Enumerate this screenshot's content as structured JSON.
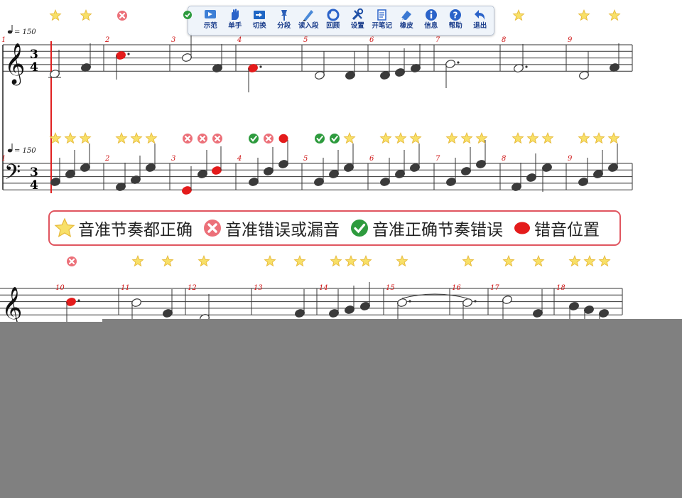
{
  "toolbar": {
    "buttons": [
      {
        "label": "示范",
        "icon": "demo-icon"
      },
      {
        "label": "单手",
        "icon": "single-hand-icon"
      },
      {
        "label": "切换",
        "icon": "switch-icon"
      },
      {
        "label": "分段",
        "icon": "segment-pin-icon"
      },
      {
        "label": "读入段",
        "icon": "load-segment-icon"
      },
      {
        "label": "回顾",
        "icon": "review-icon"
      },
      {
        "label": "设置",
        "icon": "settings-tools-icon"
      },
      {
        "label": "开笔记",
        "icon": "note-pen-icon"
      },
      {
        "label": "橡皮",
        "icon": "eraser-icon"
      },
      {
        "label": "信息",
        "icon": "info-icon"
      },
      {
        "label": "帮助",
        "icon": "help-icon"
      },
      {
        "label": "退出",
        "icon": "exit-arrow-icon"
      }
    ]
  },
  "score": {
    "tempo": "= 150",
    "time_signature": {
      "top": "3",
      "bottom": "4"
    },
    "system1_measures": [
      "1",
      "2",
      "3",
      "4",
      "5",
      "6",
      "7",
      "8",
      "9"
    ],
    "system2_measures": [
      "10",
      "11",
      "12",
      "13",
      "14",
      "15",
      "16",
      "17",
      "18"
    ],
    "treble_marks_row1": [
      [
        "star",
        "star",
        "cross"
      ],
      [],
      [],
      [],
      [],
      [],
      [],
      [
        "star"
      ],
      [
        "star",
        "star"
      ]
    ],
    "bass_marks_row1": [
      [
        "star",
        "star",
        "star"
      ],
      [
        "star",
        "star",
        "star"
      ],
      [
        "cross",
        "cross",
        "cross"
      ],
      [
        "check",
        "cross",
        "dot"
      ],
      [
        "check",
        "check",
        "star"
      ],
      [
        "star",
        "star",
        "star"
      ],
      [
        "star",
        "star",
        "star"
      ],
      [
        "star",
        "star",
        "star"
      ],
      [
        "star",
        "star",
        "star"
      ]
    ],
    "marks_row3": [
      [
        "cross"
      ],
      [
        "star",
        "star"
      ],
      [
        "star"
      ],
      [
        "star",
        "star"
      ],
      [
        "star",
        "star",
        "star"
      ],
      [
        "star"
      ],
      [
        "star"
      ],
      [
        "star",
        "star"
      ],
      [
        "star",
        "star",
        "star"
      ]
    ]
  },
  "legend": {
    "items": [
      {
        "icon": "star-icon",
        "label": "音准节奏都正确"
      },
      {
        "icon": "cross-icon",
        "label": "音准错误或漏音"
      },
      {
        "icon": "check-icon",
        "label": "音准正确节奏错误"
      },
      {
        "icon": "red-dot-icon",
        "label": "错音位置"
      }
    ]
  },
  "colors": {
    "star": "#f5d44a",
    "cross": "#e8606a",
    "check": "#2e9b3e",
    "wrong_note": "#e41b1b",
    "measure_number": "#d01818",
    "cursor": "#e02020",
    "overlay": "#808080"
  }
}
